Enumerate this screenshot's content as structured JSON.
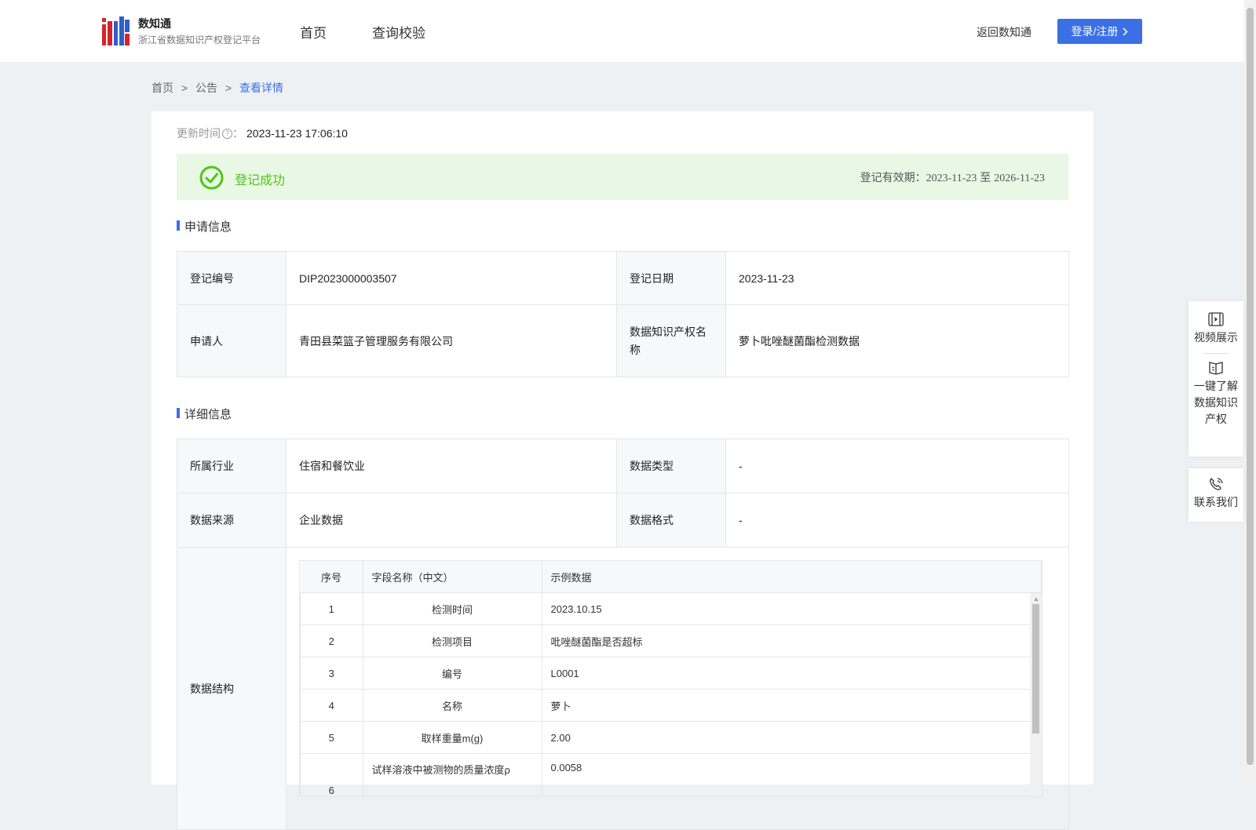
{
  "header": {
    "logo_title": "数知通",
    "logo_subtitle": "浙江省数据知识产权登记平台",
    "nav": [
      {
        "label": "首页"
      },
      {
        "label": "查询校验"
      }
    ],
    "back_link": "返回数知通",
    "login_button": "登录/注册"
  },
  "breadcrumb": {
    "items": [
      "首页",
      "公告"
    ],
    "separator": ">",
    "current": "查看详情"
  },
  "update": {
    "label": "更新时间",
    "info_icon": "question-circle-icon",
    "colon": "：",
    "value": "2023-11-23 17:06:10"
  },
  "status": {
    "text": "登记成功",
    "icon": "check-circle-icon",
    "color": "#52c41a",
    "validity_label": "登记有效期：",
    "validity_start": "2023-11-23",
    "validity_to": "至",
    "validity_end": "2026-11-23"
  },
  "application": {
    "title": "申请信息",
    "reg_no_label": "登记编号",
    "reg_no": "DIP2023000003507",
    "reg_date_label": "登记日期",
    "reg_date": "2023-11-23",
    "applicant_label": "申请人",
    "applicant": "青田县菜篮子管理服务有限公司",
    "ip_name_label": "数据知识产权名称",
    "ip_name": "萝卜吡唑醚菌酯检测数据"
  },
  "detail": {
    "title": "详细信息",
    "industry_label": "所属行业",
    "industry": "住宿和餐饮业",
    "data_type_label": "数据类型",
    "data_type": "-",
    "source_label": "数据来源",
    "source": "企业数据",
    "format_label": "数据格式",
    "format": "-",
    "structure_label": "数据结构",
    "structure": {
      "columns": [
        "序号",
        "字段名称（中文）",
        "示例数据"
      ],
      "rows": [
        {
          "no": "1",
          "field": "检测时间",
          "sample": "2023.10.15"
        },
        {
          "no": "2",
          "field": "检测项目",
          "sample": "吡唑醚菌酯是否超标"
        },
        {
          "no": "3",
          "field": "编号",
          "sample": "L0001"
        },
        {
          "no": "4",
          "field": "名称",
          "sample": "萝卜"
        },
        {
          "no": "5",
          "field": "取样重量m(g)",
          "sample": "2.00"
        },
        {
          "no": "6",
          "field": "试样溶液中被测物的质量浓度ρ",
          "sample": "0.0058"
        }
      ]
    }
  },
  "float_panel": {
    "video": {
      "label": "视频展示",
      "icon": "video-icon"
    },
    "learn": {
      "label": "一键了解数据知识产权",
      "icon": "book-icon"
    },
    "contact": {
      "label": "联系我们",
      "icon": "phone-icon"
    }
  },
  "colors": {
    "accent": "#3b6fe6",
    "success_bg": "#e8f8e4",
    "page_bg": "#eef1f4"
  }
}
